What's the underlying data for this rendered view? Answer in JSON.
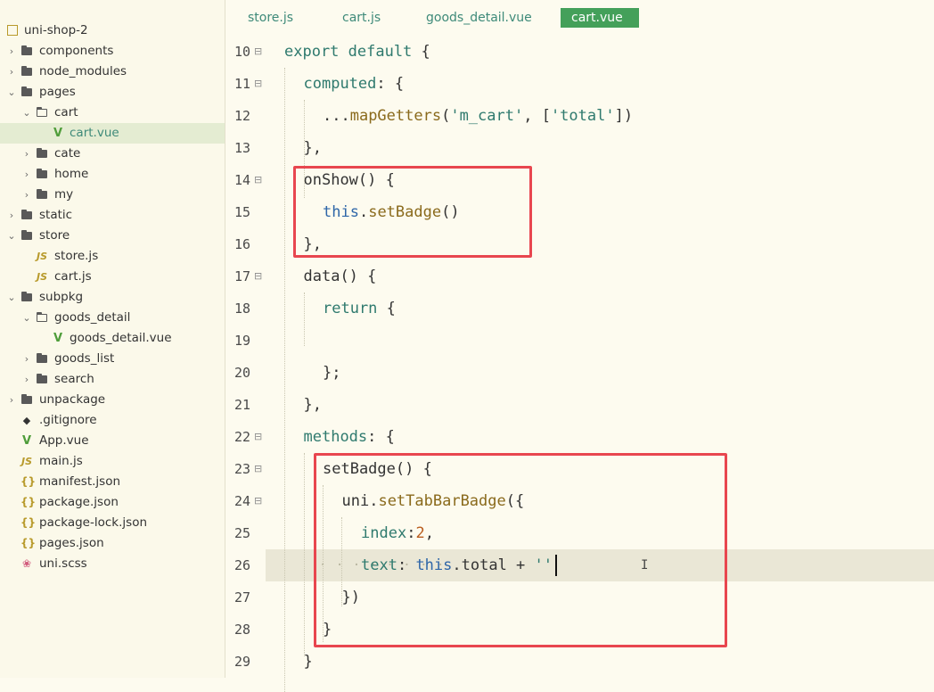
{
  "sidebar": {
    "items": [
      {
        "label": "uni-shop-2",
        "icon": "project-icon"
      },
      {
        "label": "components",
        "icon": "folder-icon"
      },
      {
        "label": "node_modules",
        "icon": "folder-icon"
      },
      {
        "label": "pages",
        "icon": "folder-icon"
      },
      {
        "label": "cart",
        "icon": "folder-open-icon"
      },
      {
        "label": "cart.vue",
        "icon": "vue-file-icon"
      },
      {
        "label": "cate",
        "icon": "folder-icon"
      },
      {
        "label": "home",
        "icon": "folder-icon"
      },
      {
        "label": "my",
        "icon": "folder-icon"
      },
      {
        "label": "static",
        "icon": "folder-icon"
      },
      {
        "label": "store",
        "icon": "folder-icon"
      },
      {
        "label": "store.js",
        "icon": "js-file-icon"
      },
      {
        "label": "cart.js",
        "icon": "js-file-icon"
      },
      {
        "label": "subpkg",
        "icon": "folder-icon"
      },
      {
        "label": "goods_detail",
        "icon": "folder-open-icon"
      },
      {
        "label": "goods_detail.vue",
        "icon": "vue-file-icon"
      },
      {
        "label": "goods_list",
        "icon": "folder-icon"
      },
      {
        "label": "search",
        "icon": "folder-icon"
      },
      {
        "label": "unpackage",
        "icon": "folder-icon"
      },
      {
        "label": ".gitignore",
        "icon": "git-file-icon"
      },
      {
        "label": "App.vue",
        "icon": "vue-file-icon"
      },
      {
        "label": "main.js",
        "icon": "js-file-icon"
      },
      {
        "label": "manifest.json",
        "icon": "json-file-icon"
      },
      {
        "label": "package.json",
        "icon": "json-file-icon"
      },
      {
        "label": "package-lock.json",
        "icon": "json-file-icon"
      },
      {
        "label": "pages.json",
        "icon": "json-file-icon"
      },
      {
        "label": "uni.scss",
        "icon": "scss-file-icon"
      }
    ],
    "selected": "cart.vue"
  },
  "tabs": [
    {
      "label": "store.js",
      "active": false
    },
    {
      "label": "cart.js",
      "active": false
    },
    {
      "label": "goods_detail.vue",
      "active": false
    },
    {
      "label": "cart.vue",
      "active": true
    }
  ],
  "editor": {
    "current_line": 26,
    "lines": [
      {
        "n": "10",
        "t": [
          {
            "c": "kw",
            "s": "export default "
          },
          {
            "c": "pun",
            "s": "{"
          }
        ]
      },
      {
        "n": "11",
        "t": [
          {
            "c": "kw",
            "s": "computed"
          },
          {
            "c": "pun",
            "s": ": {"
          }
        ]
      },
      {
        "n": "12",
        "t": [
          {
            "c": "pun",
            "s": "..."
          },
          {
            "c": "fn",
            "s": "mapGetters"
          },
          {
            "c": "pun",
            "s": "("
          },
          {
            "c": "str",
            "s": "'m_cart'"
          },
          {
            "c": "pun",
            "s": ", ["
          },
          {
            "c": "str",
            "s": "'total'"
          },
          {
            "c": "pun",
            "s": "])"
          }
        ]
      },
      {
        "n": "13",
        "t": [
          {
            "c": "pun",
            "s": "},"
          }
        ]
      },
      {
        "n": "14",
        "t": [
          {
            "c": "pun",
            "s": "onShow() {"
          }
        ]
      },
      {
        "n": "15",
        "t": [
          {
            "c": "th",
            "s": "this"
          },
          {
            "c": "pun",
            "s": "."
          },
          {
            "c": "fn",
            "s": "setBadge"
          },
          {
            "c": "pun",
            "s": "()"
          }
        ]
      },
      {
        "n": "16",
        "t": [
          {
            "c": "pun",
            "s": "},"
          }
        ]
      },
      {
        "n": "17",
        "t": [
          {
            "c": "pun",
            "s": "data() {"
          }
        ]
      },
      {
        "n": "18",
        "t": [
          {
            "c": "kw",
            "s": "return "
          },
          {
            "c": "pun",
            "s": "{"
          }
        ]
      },
      {
        "n": "19",
        "t": []
      },
      {
        "n": "20",
        "t": [
          {
            "c": "pun",
            "s": "};"
          }
        ]
      },
      {
        "n": "21",
        "t": [
          {
            "c": "pun",
            "s": "},"
          }
        ]
      },
      {
        "n": "22",
        "t": [
          {
            "c": "kw",
            "s": "methods"
          },
          {
            "c": "pun",
            "s": ": {"
          }
        ]
      },
      {
        "n": "23",
        "t": [
          {
            "c": "pun",
            "s": "setBadge() {"
          }
        ]
      },
      {
        "n": "24",
        "t": [
          {
            "c": "pun",
            "s": "uni."
          },
          {
            "c": "fn",
            "s": "setTabBarBadge"
          },
          {
            "c": "pun",
            "s": "({"
          }
        ]
      },
      {
        "n": "25",
        "t": [
          {
            "c": "kw",
            "s": "index"
          },
          {
            "c": "pun",
            "s": ":"
          },
          {
            "c": "num",
            "s": "2"
          },
          {
            "c": "pun",
            "s": ","
          }
        ]
      },
      {
        "n": "26",
        "t": [
          {
            "c": "kw",
            "s": "text"
          },
          {
            "c": "pun",
            "s": ": "
          },
          {
            "c": "th",
            "s": "this"
          },
          {
            "c": "pun",
            "s": ".total + "
          },
          {
            "c": "str",
            "s": "''"
          }
        ]
      },
      {
        "n": "27",
        "t": [
          {
            "c": "pun",
            "s": "})"
          }
        ]
      },
      {
        "n": "28",
        "t": [
          {
            "c": "pun",
            "s": "}"
          }
        ]
      },
      {
        "n": "29",
        "t": [
          {
            "c": "pun",
            "s": "}"
          }
        ]
      }
    ]
  },
  "colors": {
    "highlight_box": "#e8464f",
    "active_tab": "#44a05a",
    "current_line": "#eae7d6"
  }
}
